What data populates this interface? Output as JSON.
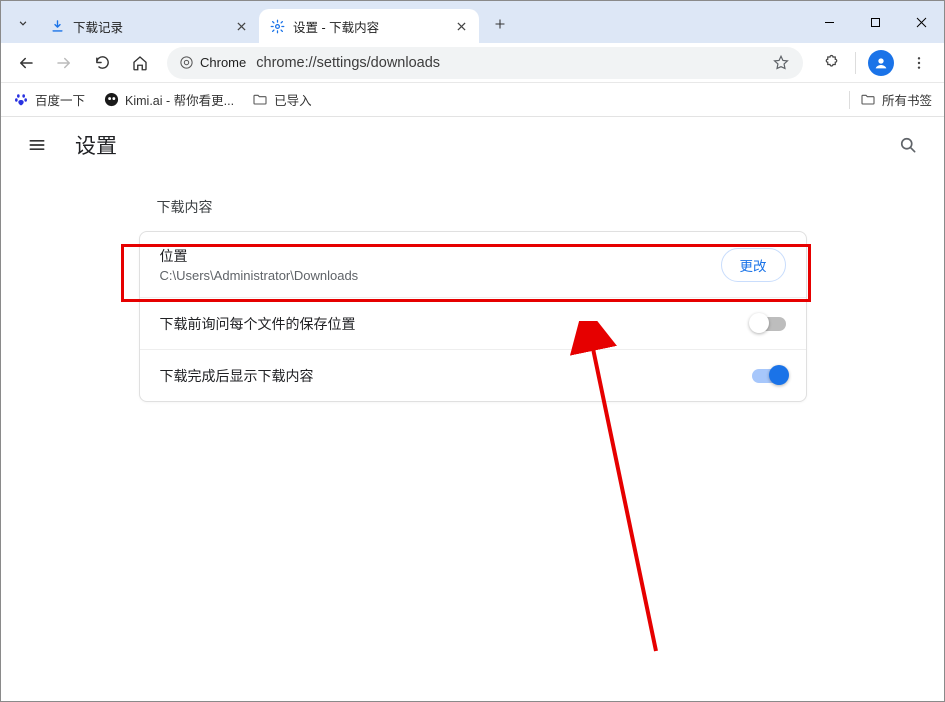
{
  "window": {
    "tabs": [
      {
        "title": "下载记录",
        "favicon": "download"
      },
      {
        "title": "设置 - 下载内容",
        "favicon": "gear"
      }
    ]
  },
  "toolbar": {
    "origin_label": "Chrome",
    "url": "chrome://settings/downloads"
  },
  "bookmarks": {
    "items": [
      {
        "label": "百度一下",
        "icon": "baidu"
      },
      {
        "label": "Kimi.ai - 帮你看更...",
        "icon": "kimi"
      },
      {
        "label": "已导入",
        "icon": "folder"
      }
    ],
    "all_bookmarks_label": "所有书签"
  },
  "settings": {
    "app_title": "设置",
    "section_heading": "下载内容",
    "location_label": "位置",
    "location_path": "C:\\Users\\Administrator\\Downloads",
    "change_button": "更改",
    "ask_each_time_label": "下载前询问每个文件的保存位置",
    "ask_each_time_on": false,
    "show_on_complete_label": "下载完成后显示下载内容",
    "show_on_complete_on": true
  }
}
